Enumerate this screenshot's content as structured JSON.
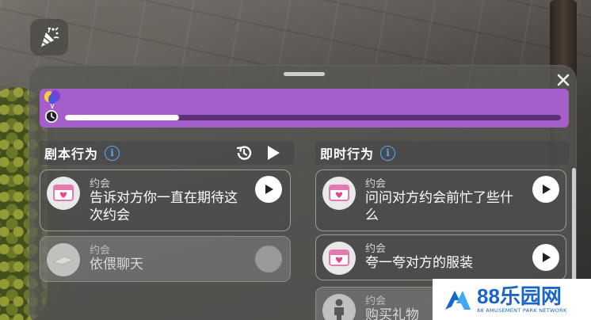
{
  "progress": {
    "value_percent": 23,
    "fill_color": "#ffffff",
    "bar_color": "#a45fca"
  },
  "script_actions": {
    "title": "剧本行为",
    "cards": [
      {
        "category": "约会",
        "text": "告诉对方你一直在期待这次约会",
        "enabled": true
      },
      {
        "category": "约会",
        "text": "依偎聊天",
        "enabled": false
      }
    ]
  },
  "instant_actions": {
    "title": "即时行为",
    "cards": [
      {
        "category": "约会",
        "text": "问问对方约会前忙了些什么",
        "enabled": true
      },
      {
        "category": "约会",
        "text": "夸一夸对方的服装",
        "enabled": true
      },
      {
        "category": "约会",
        "text": "购买礼物",
        "enabled": false
      }
    ]
  },
  "icons": {
    "top": "party-popper-icon",
    "close": "close-icon",
    "info": "info-icon",
    "history": "history-icon",
    "play": "play-icon"
  },
  "watermark": {
    "title": "88乐园网",
    "subtitle": "88 AMUSEMENT PARK NETWORK"
  }
}
